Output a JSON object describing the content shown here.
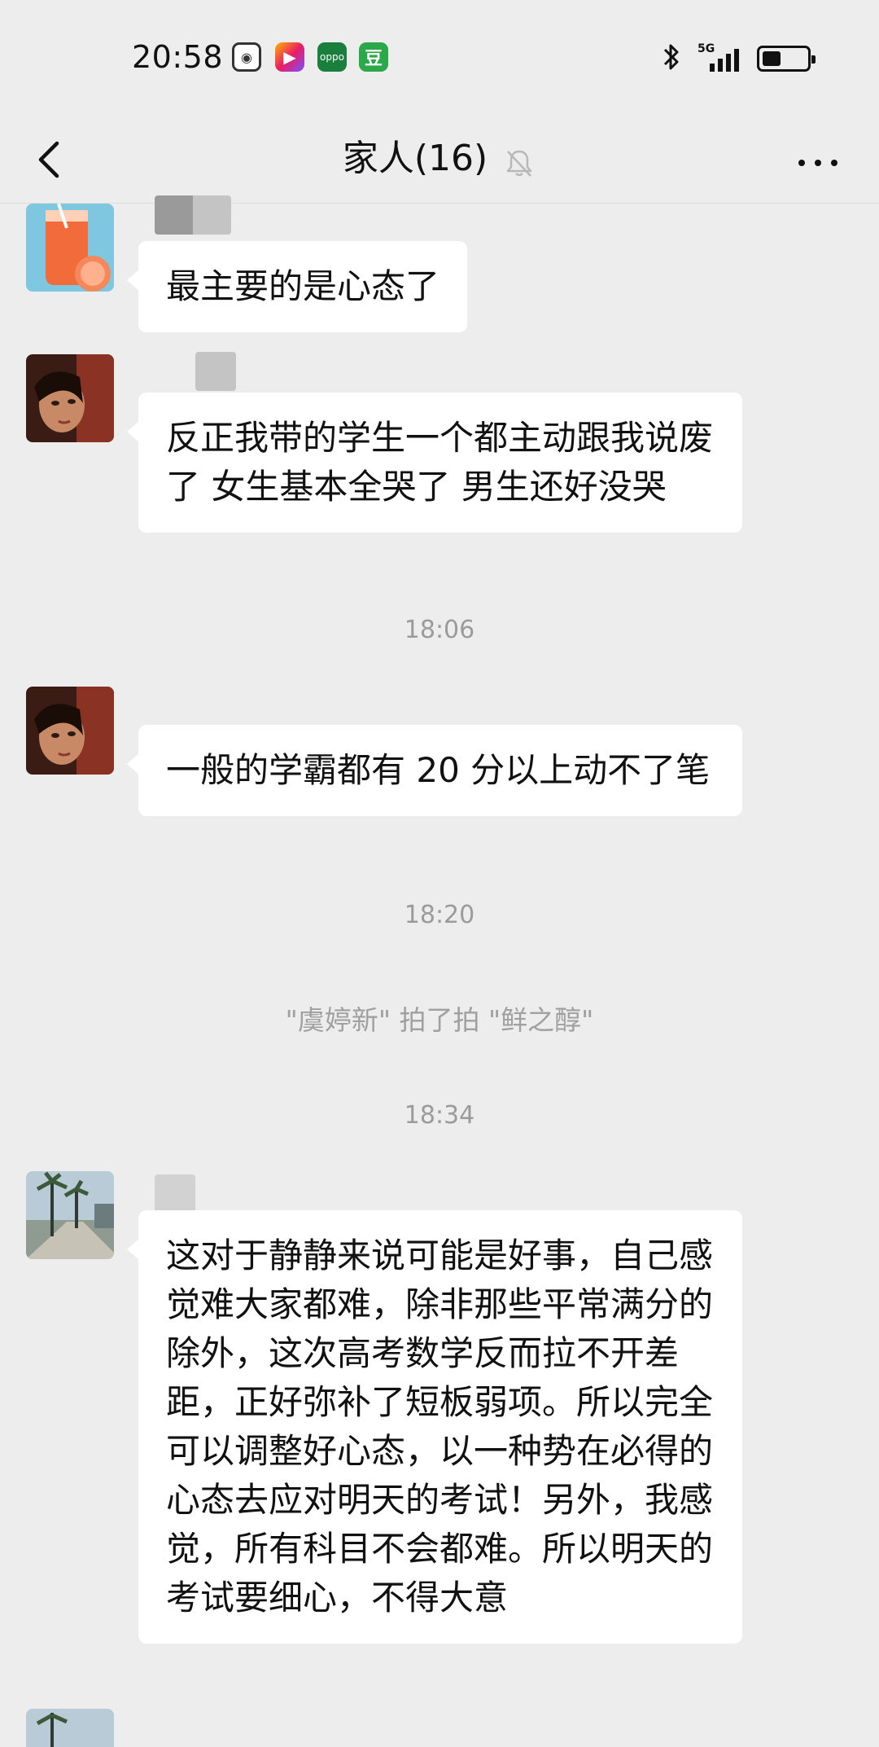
{
  "status_bar": {
    "time": "20:58",
    "app_icons": [
      "camera-app-icon",
      "video-app-icon",
      "oppo-app-icon",
      "douban-app-icon"
    ],
    "oppo_label": "oppo",
    "douban_label": "豆",
    "network": "5G",
    "battery_percent": 40
  },
  "header": {
    "title": "家人(16)",
    "muted": true
  },
  "messages": [
    {
      "type": "message",
      "avatar": "grapefruit-drink-avatar",
      "text": "最主要的是心态了"
    },
    {
      "type": "message",
      "avatar": "woman-portrait-avatar",
      "text": "反正我带的学生一个都主动跟我说废了 女生基本全哭了 男生还好没哭"
    },
    {
      "type": "timestamp",
      "text": "18:06"
    },
    {
      "type": "message",
      "avatar": "woman-portrait-avatar",
      "text": "一般的学霸都有 20 分以上动不了笔"
    },
    {
      "type": "timestamp",
      "text": "18:20"
    },
    {
      "type": "system",
      "text": "\"虞婷新\" 拍了拍 \"鲜之醇\""
    },
    {
      "type": "timestamp",
      "text": "18:34"
    },
    {
      "type": "message",
      "avatar": "street-palm-trees-avatar",
      "text": "这对于静静来说可能是好事，自己感觉难大家都难，除非那些平常满分的除外，这次高考数学反而拉不开差距，正好弥补了短板弱项。所以完全可以调整好心态，以一种势在必得的心态去应对明天的考试！另外，我感觉，所有科目不会都难。所以明天的考试要细心，不得大意"
    }
  ],
  "colors": {
    "background": "#ededed",
    "bubble": "#ffffff",
    "timestamp": "#9b9b9b"
  }
}
